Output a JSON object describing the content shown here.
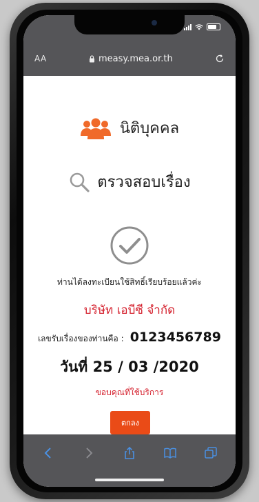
{
  "browser": {
    "text_size_label": "AA",
    "url": "measy.mea.or.th"
  },
  "page": {
    "title": "นิติบุคคล",
    "check_title": "ตรวจสอบเรื่อง",
    "success_message": "ท่านได้ลงทะเบียนใช้สิทธิ์เรียบร้อยแล้วค่ะ",
    "company_name": "บริษัท เอบีซี จำกัด",
    "reference_label": "เลขรับเรื่องของท่านคือ :",
    "reference_number": "0123456789",
    "date_text": "วันที่ 25 / 03 /2020",
    "thanks_text": "ขอบคุณที่ใช้บริการ",
    "ok_button": "ตกลง"
  },
  "colors": {
    "accent_red": "#d41f2c",
    "button_orange": "#ea4b17",
    "icon_orange": "#f06a2a",
    "browser_chrome": "#555558"
  },
  "icons": [
    "group-icon",
    "search-icon",
    "check-circle-icon",
    "back-icon",
    "forward-icon",
    "share-icon",
    "bookmarks-icon",
    "tabs-icon",
    "lock-icon",
    "reload-icon"
  ]
}
